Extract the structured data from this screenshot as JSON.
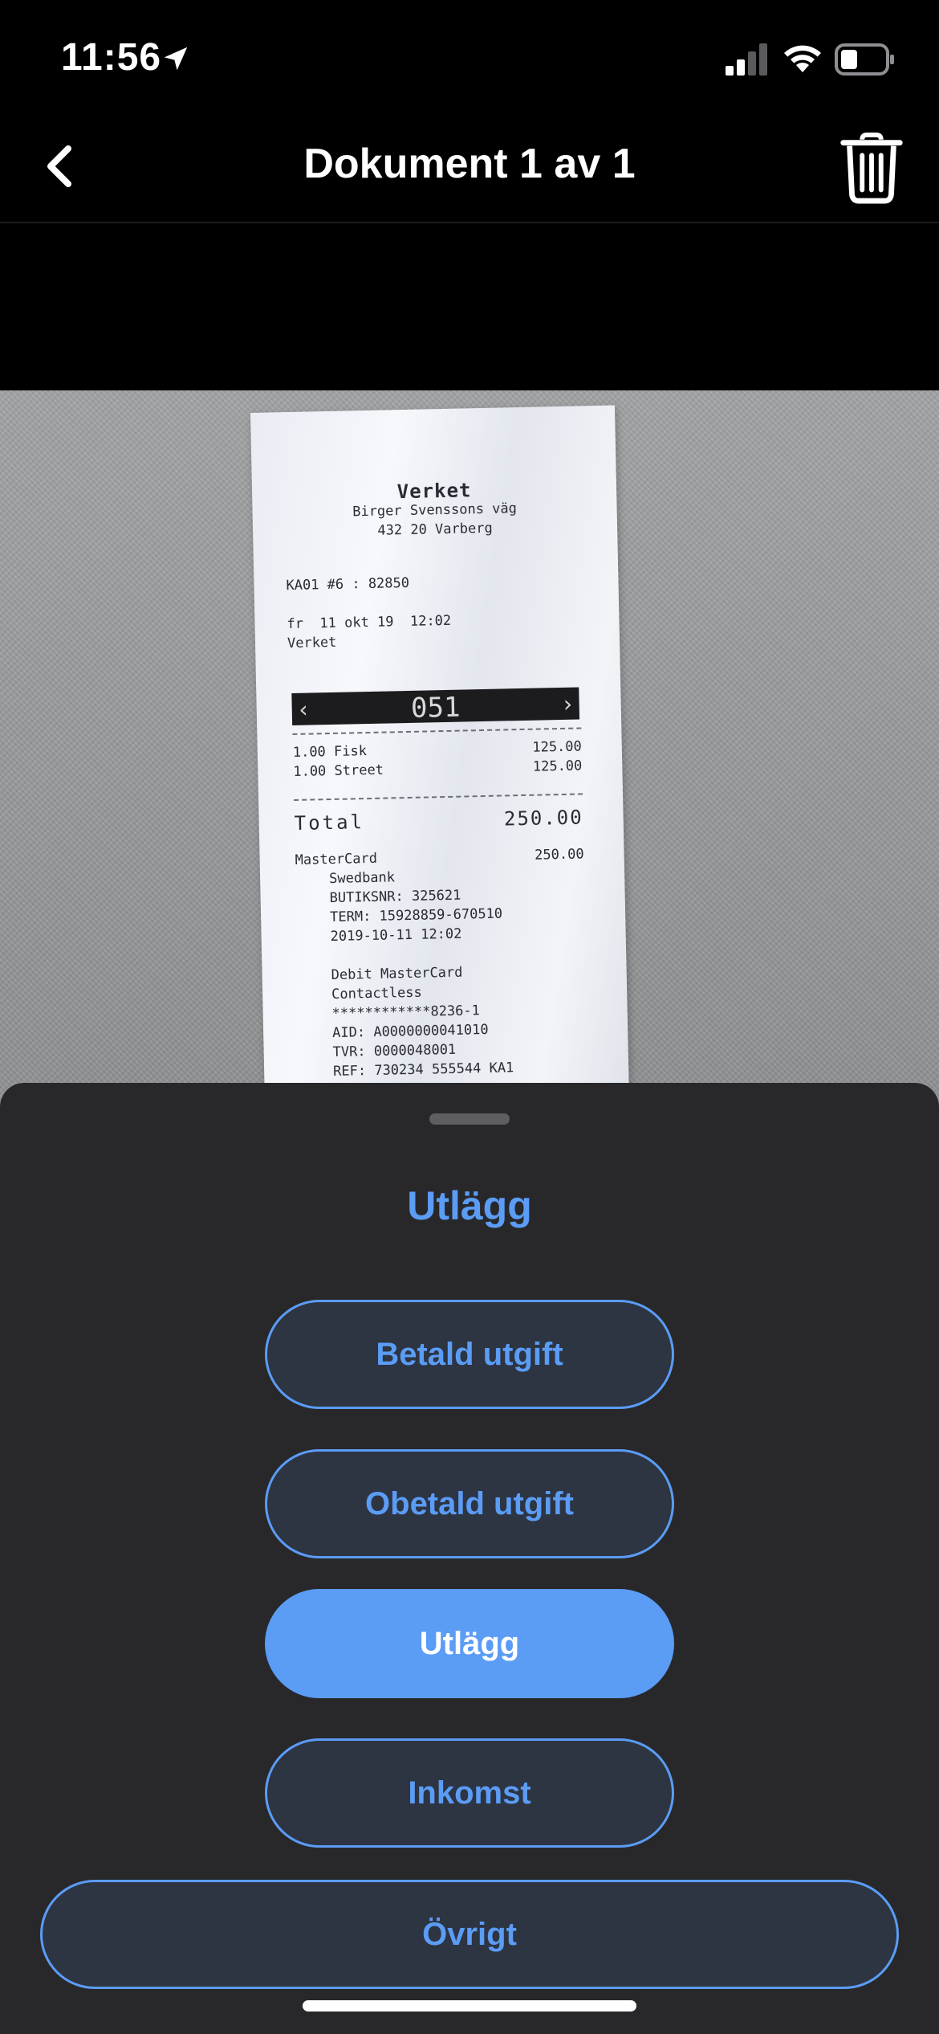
{
  "status_bar": {
    "time": "11:56"
  },
  "nav": {
    "title": "Dokument 1 av 1"
  },
  "receipt": {
    "store_name": "Verket",
    "street": "Birger Svenssons väg",
    "city": "432 20  Varberg",
    "register": "KA01 #6 : 82850",
    "datetime": "fr  11 okt 19  12:02",
    "location": "Verket",
    "ticket_number": "051",
    "items": [
      {
        "label": "1.00 Fisk",
        "amount": "125.00"
      },
      {
        "label": "1.00 Street",
        "amount": "125.00"
      }
    ],
    "total_label": "Total",
    "total_value": "250.00",
    "card_label": "MasterCard",
    "card_amount": "250.00",
    "bank": "Swedbank",
    "store_no": "BUTIKSNR: 325621",
    "term": "TERM: 15928859-670510",
    "card_datetime": "2019-10-11 12:02",
    "card_type": "Debit MasterCard",
    "contactless": "Contactless",
    "card_number": "************8236-1",
    "aid": "AID: A0000000041010",
    "tvr": "TVR: 0000048001",
    "ref": "REF: 730234 555544 KA1"
  },
  "sheet": {
    "title": "Utlägg",
    "options": [
      {
        "label": "Betald utgift",
        "selected": false
      },
      {
        "label": "Obetald utgift",
        "selected": false
      },
      {
        "label": "Utlägg",
        "selected": true
      },
      {
        "label": "Inkomst",
        "selected": false
      },
      {
        "label": "Övrigt",
        "selected": false
      }
    ]
  },
  "colors": {
    "accent": "#5b9cf5",
    "sheet_bg": "#28282b",
    "button_bg": "#2d3442"
  }
}
